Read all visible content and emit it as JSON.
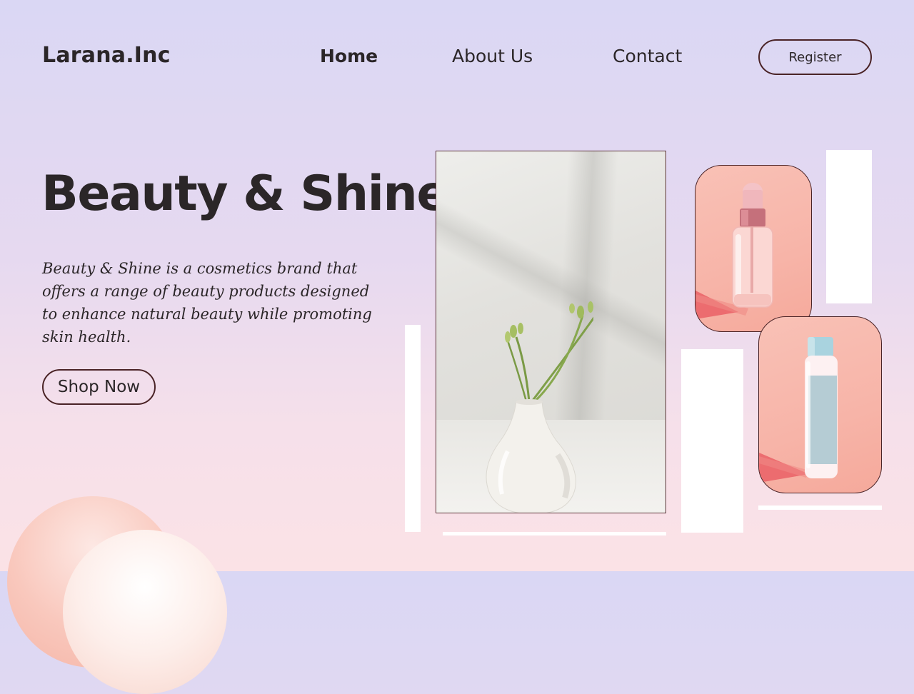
{
  "header": {
    "logo": "Larana.Inc",
    "nav": [
      {
        "label": "Home",
        "active": true
      },
      {
        "label": "About Us",
        "active": false
      },
      {
        "label": "Contact",
        "active": false
      }
    ],
    "register_label": "Register"
  },
  "hero": {
    "title": "Beauty & Shine",
    "description": "Beauty & Shine is a cosmetics brand that offers a range of beauty products designed to enhance natural beauty while promoting skin health.",
    "cta_label": "Shop Now"
  },
  "images": {
    "main_photo": "vase-with-flower-stems",
    "product_1": "serum-dropper-bottle",
    "product_2": "lotion-bottle"
  },
  "colors": {
    "background_top": "#dad7f4",
    "background_bottom": "#fbe2e6",
    "text": "#2b2628",
    "button_border": "#4a2326",
    "product_card_bg": "#f7b4a8"
  }
}
